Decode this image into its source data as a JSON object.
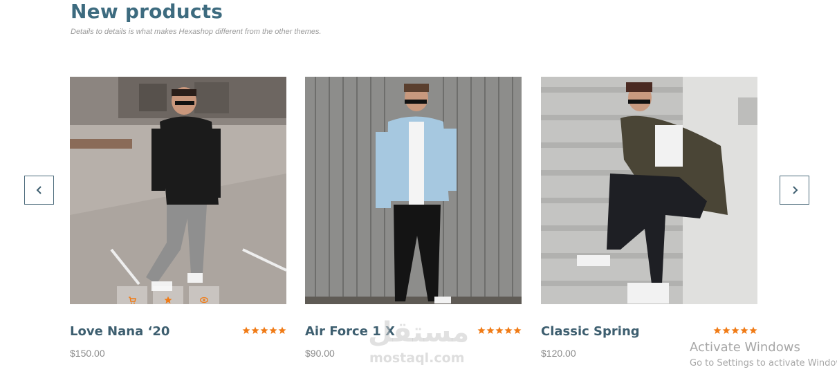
{
  "section": {
    "title": "New products",
    "subtitle": "Details to details is what makes Hexashop different from the other themes."
  },
  "carousel": {
    "prev_icon": "chevron-left-icon",
    "next_icon": "chevron-right-icon"
  },
  "products": [
    {
      "name": "Love Nana ‘20",
      "price": "$150.00",
      "rating": 5
    },
    {
      "name": "Air Force 1 X",
      "price": "$90.00",
      "rating": 5
    },
    {
      "name": "Classic Spring",
      "price": "$120.00",
      "rating": 5
    }
  ],
  "hover_actions": [
    "eye-icon",
    "star-icon",
    "cart-icon"
  ],
  "watermark": {
    "arabic": "مستقل",
    "latin": "mostaql.com"
  },
  "os_notice": {
    "title": "Activate Windows",
    "subtitle": "Go to Settings to activate Windows."
  },
  "colors": {
    "accent": "#f07b16",
    "heading": "#3d6b7f",
    "product_name": "#3d5e6f"
  }
}
